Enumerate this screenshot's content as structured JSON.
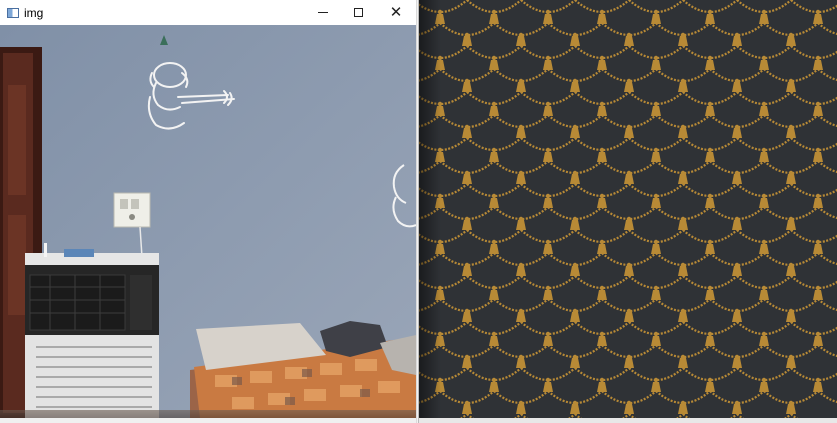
{
  "window": {
    "title": "img",
    "buttons": {
      "minimize_icon": "minimize-icon",
      "maximize_icon": "maximize-icon",
      "close_icon": "close-icon",
      "close_glyph": "✕"
    }
  },
  "colors": {
    "wall": "#7f8fa6",
    "door": "#4a1f17",
    "cooler_body": "#e5e5e5",
    "cooler_top": "#2b2b2b",
    "bed_cover": "#c36b38",
    "pattern_background": "#2f3236",
    "pattern_gold": "#b88a36"
  },
  "icons": {
    "app": "image-window-icon"
  }
}
